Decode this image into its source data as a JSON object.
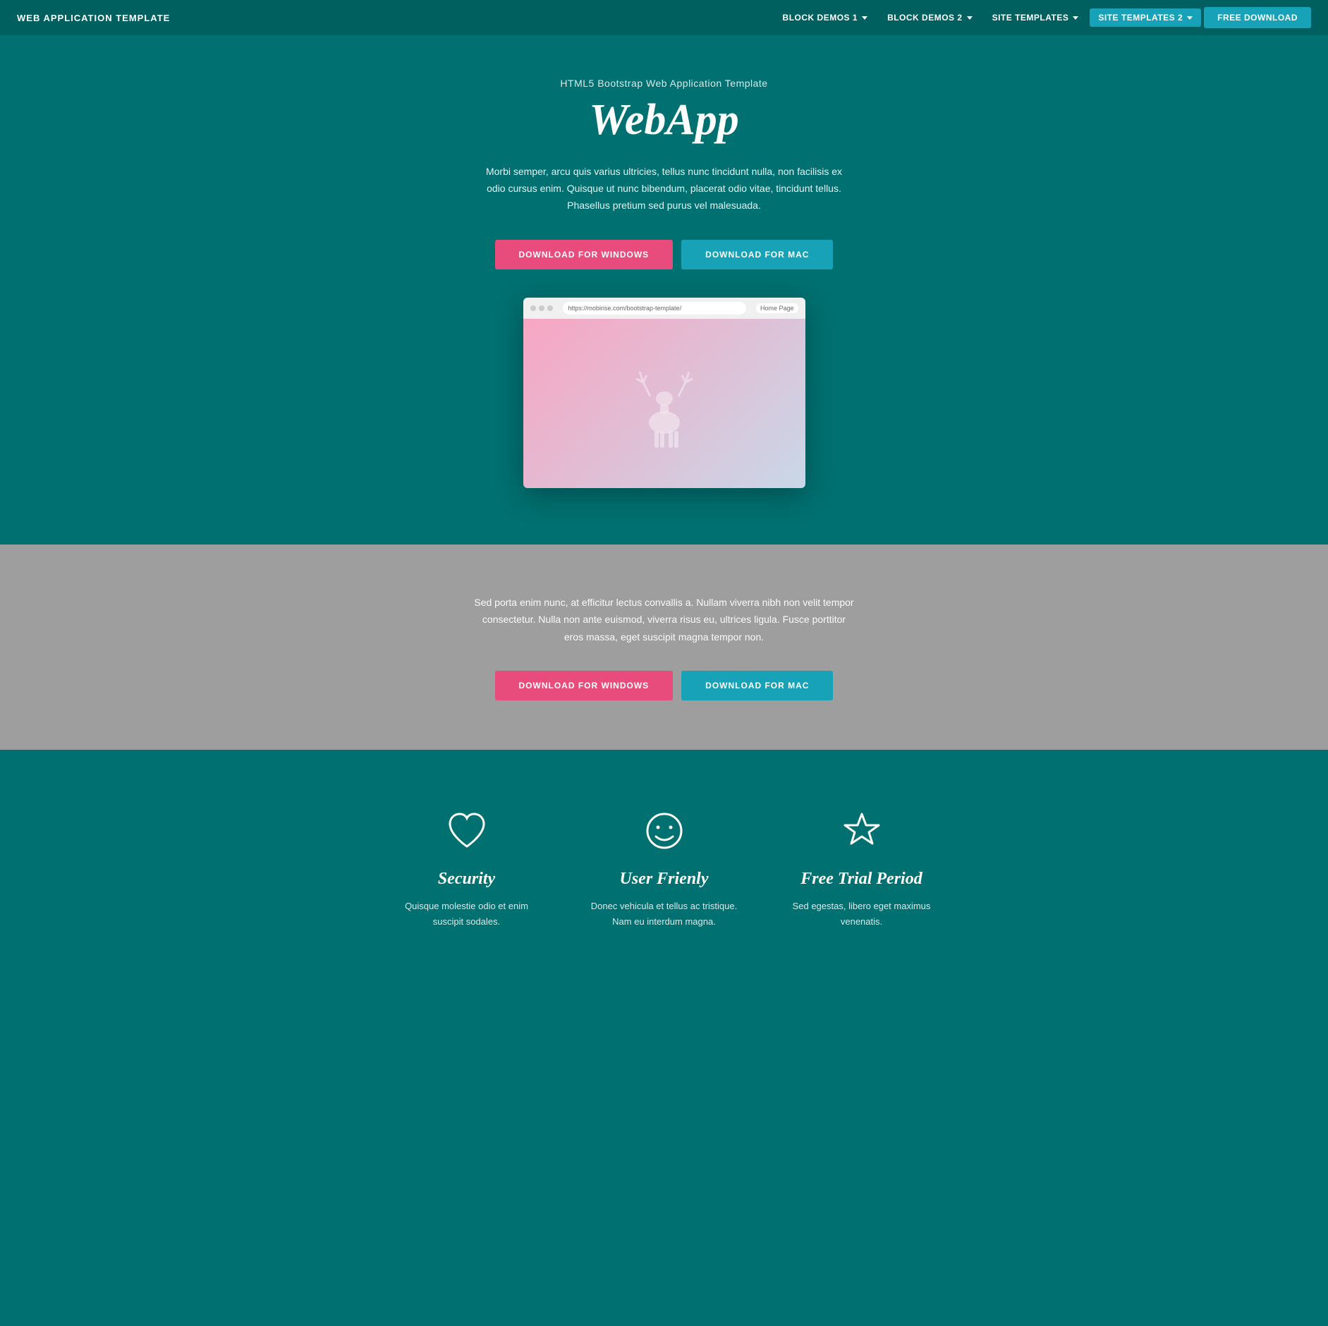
{
  "navbar": {
    "brand": "WEB APPLICATION TEMPLATE",
    "nav_items": [
      {
        "id": "block-demos-1",
        "label": "BLOCK DEMOS 1",
        "has_dropdown": true
      },
      {
        "id": "block-demos-2",
        "label": "BLOCK DEMOS 2",
        "has_dropdown": true
      },
      {
        "id": "site-templates",
        "label": "SITE TEMPLATES",
        "has_dropdown": true
      },
      {
        "id": "site-templates-2",
        "label": "SITE TEMPLATES 2",
        "has_dropdown": true,
        "active": true
      }
    ],
    "free_download_label": "FREE DOWNLOAD"
  },
  "hero": {
    "subtitle": "HTML5 Bootstrap Web Application Template",
    "title": "WebApp",
    "description": "Morbi semper, arcu quis varius ultricies, tellus nunc tincidunt nulla, non facilisis ex odio cursus enim. Quisque ut nunc bibendum, placerat odio vitae, tincidunt tellus. Phasellus pretium sed purus vel malesuada.",
    "btn_windows": "DOWNLOAD FOR WINDOWS",
    "btn_mac": "DOWNLOAD FOR MAC",
    "browser_url": "https://mobirise.com/bootstrap-template/",
    "browser_home": "Home Page"
  },
  "gray_section": {
    "description": "Sed porta enim nunc, at efficitur lectus convallis a. Nullam viverra nibh non velit tempor consectetur. Nulla non ante euismod, viverra risus eu, ultrices ligula. Fusce porttitor eros massa, eget suscipit magna tempor non.",
    "btn_windows": "DOWNLOAD FOR WINDOWS",
    "btn_mac": "DOWNLOAD FOR MAC"
  },
  "features": {
    "items": [
      {
        "id": "security",
        "icon": "heart",
        "title": "Security",
        "description": "Quisque molestie odio et enim suscipit sodales."
      },
      {
        "id": "user-friendly",
        "icon": "smiley",
        "title": "User Frienly",
        "description": "Donec vehicula et tellus ac tristique. Nam eu interdum magna."
      },
      {
        "id": "free-trial",
        "icon": "star",
        "title": "Free Trial Period",
        "description": "Sed egestas, libero eget maximus venenatis."
      }
    ]
  }
}
